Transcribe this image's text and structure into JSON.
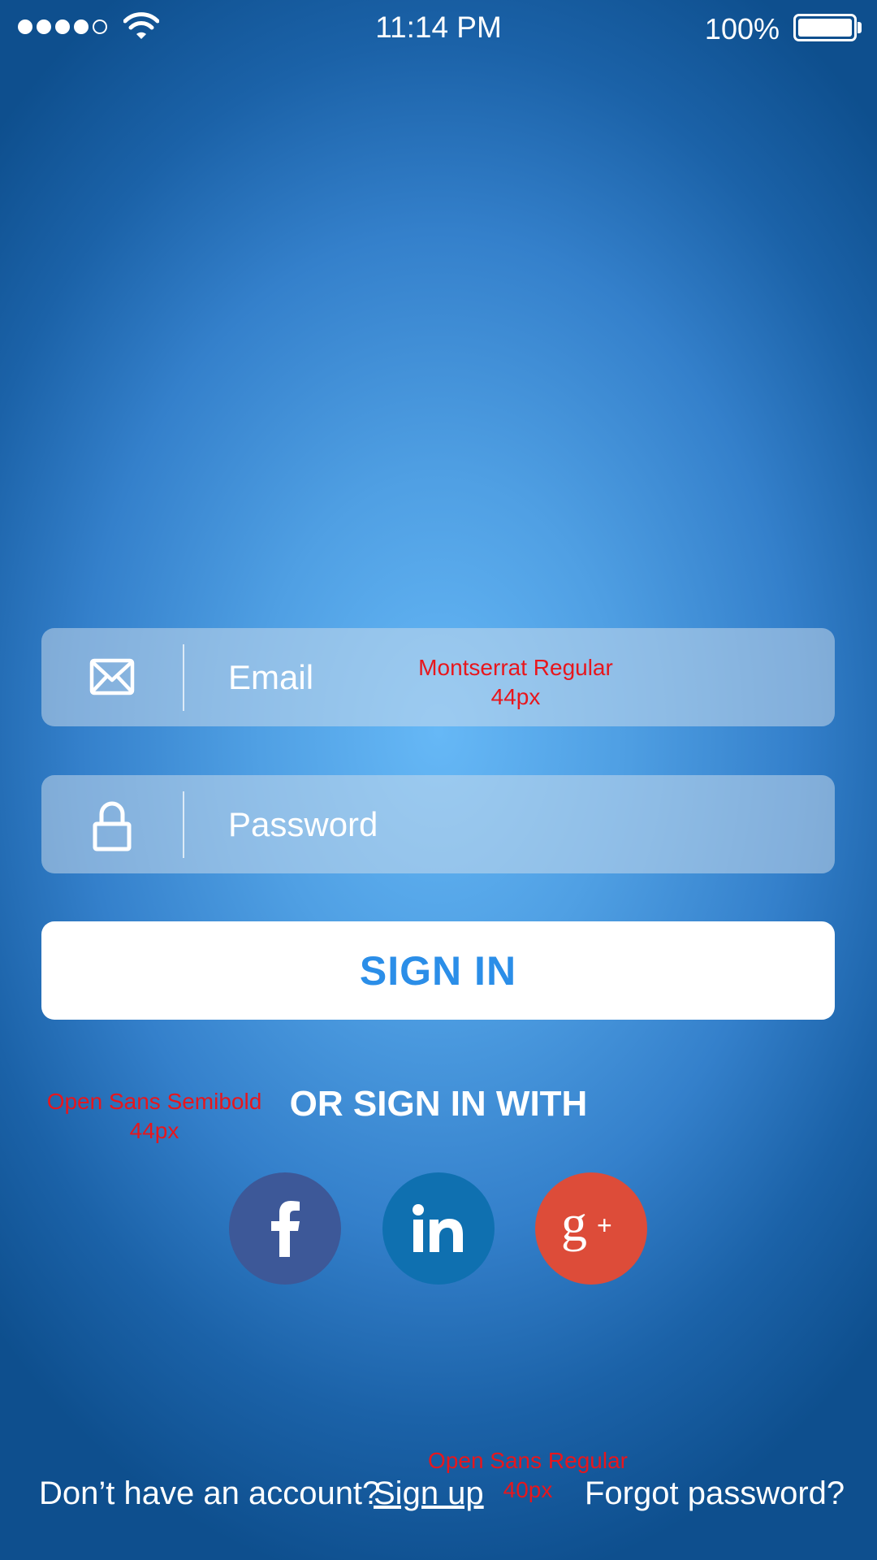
{
  "status_bar": {
    "time": "11:14 PM",
    "battery_percent": "100%",
    "signal_bars_filled": 4,
    "signal_bars_total": 5,
    "battery_level": 1.0
  },
  "form": {
    "email_placeholder": "Email",
    "password_placeholder": "Password",
    "sign_in_label": "SIGN IN",
    "or_sign_in_with": "OR SIGN IN WITH"
  },
  "annotations": {
    "email_font": "Montserrat Regular",
    "email_size": "44px",
    "or_sign_in_font": "Open Sans Semibold",
    "or_sign_in_size": "44px",
    "bottom_font": "Open Sans Regular",
    "bottom_size": "40px"
  },
  "social": [
    {
      "name": "facebook",
      "icon": "facebook-icon",
      "color": "#3d5898"
    },
    {
      "name": "linkedin",
      "icon": "linkedin-icon",
      "color": "#0f70b0"
    },
    {
      "name": "google-plus",
      "icon": "google-plus-icon",
      "color": "#dd4c39"
    }
  ],
  "footer": {
    "no_account": "Don’t have an account?",
    "sign_up": "Sign up",
    "forgot_password": "Forgot password?"
  },
  "colors": {
    "accent": "#2b8ee8",
    "annotation": "#e8161c"
  }
}
